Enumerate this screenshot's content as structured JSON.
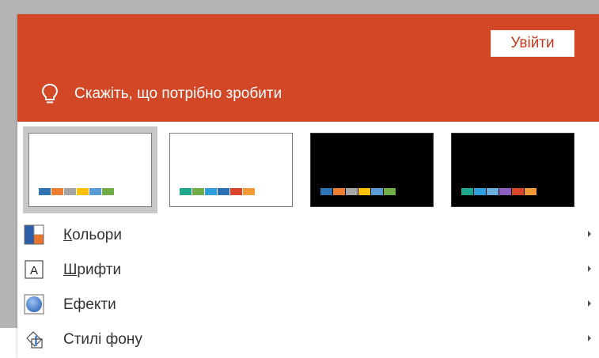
{
  "header": {
    "signin_label": "Увійти",
    "tell_me_text": "Скажіть, що потрібно зробити",
    "accent_color": "#d24726"
  },
  "themes": [
    {
      "variant": "light",
      "selected": true,
      "swatches": [
        "#2e74b5",
        "#ed7d31",
        "#a5a5a5",
        "#ffc000",
        "#5b9bd5",
        "#70ad47"
      ]
    },
    {
      "variant": "light",
      "selected": false,
      "swatches": [
        "#1ea88e",
        "#70ad47",
        "#2e9fdc",
        "#2d6fb5",
        "#d9452b",
        "#f29b36"
      ]
    },
    {
      "variant": "dark",
      "selected": false,
      "swatches": [
        "#2e74b5",
        "#ed7d31",
        "#a5a5a5",
        "#ffc000",
        "#5b9bd5",
        "#70ad47"
      ]
    },
    {
      "variant": "dark",
      "selected": false,
      "swatches": [
        "#1ea88e",
        "#2e9fdc",
        "#6ab0de",
        "#8b5fbf",
        "#d9452b",
        "#f29b36"
      ]
    }
  ],
  "menu": {
    "colors": {
      "first": "К",
      "rest": "ольори",
      "icon": "colors-icon"
    },
    "fonts": {
      "first": "Ш",
      "rest": "рифти",
      "icon": "fonts-icon"
    },
    "effects": {
      "label": "Ефекти",
      "icon": "effects-icon"
    },
    "background": {
      "label": "Стилі фону",
      "icon": "background-styles-icon"
    }
  }
}
